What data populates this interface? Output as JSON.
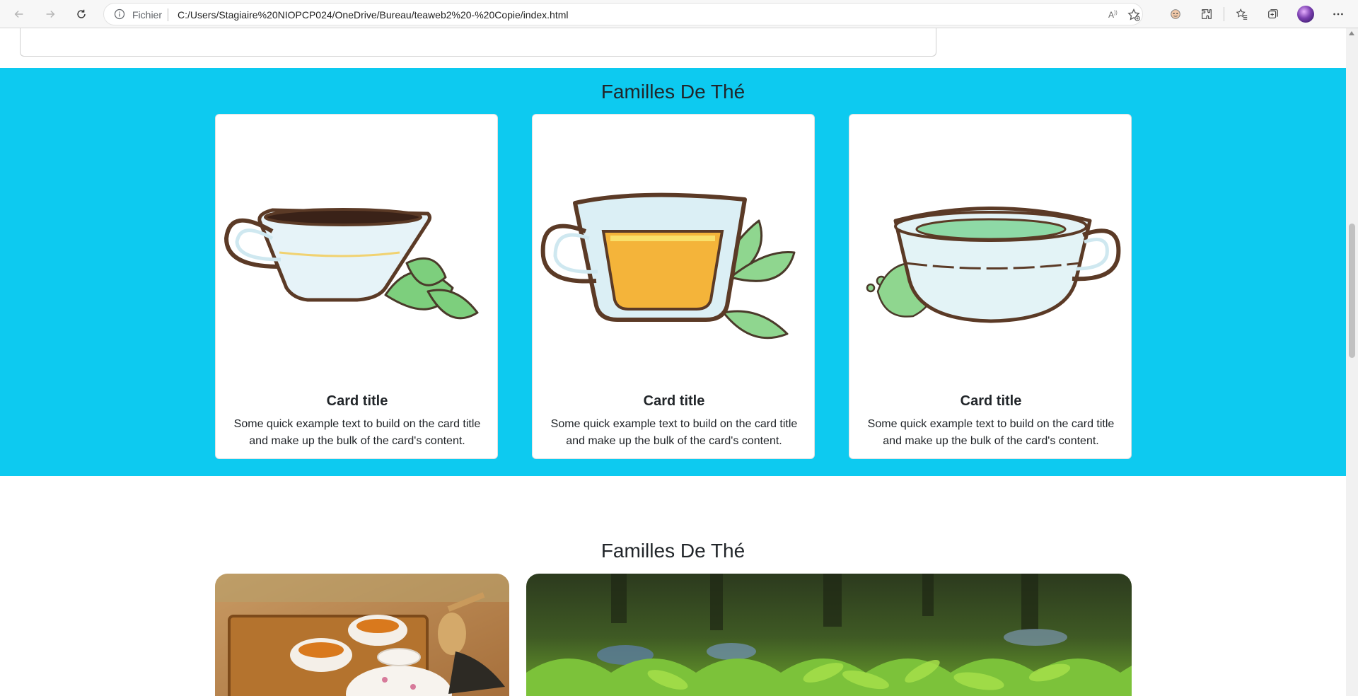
{
  "browser": {
    "scheme_label": "Fichier",
    "url": "C:/Users/Stagiaire%20NIOPCP024/OneDrive/Bureau/teaweb2%20-%20Copie/index.html",
    "icons": [
      "back-icon",
      "forward-icon",
      "refresh-icon",
      "info-icon",
      "read-aloud-icon",
      "add-favorite-icon",
      "extension-puzzle-icon",
      "extensions-icon",
      "favorites-icon",
      "collections-icon",
      "profile-avatar",
      "more-icon"
    ]
  },
  "featured_section": {
    "title": "Familles De Thé",
    "background_color": "#0dcaf0",
    "cards": [
      {
        "title": "Card title",
        "text": "Some quick example text to build on the card title and make up the bulk of the card's content.",
        "image": "black-tea-cup-illustration"
      },
      {
        "title": "Card title",
        "text": "Some quick example text to build on the card title and make up the bulk of the card's content.",
        "image": "golden-tea-glass-illustration"
      },
      {
        "title": "Card title",
        "text": "Some quick example text to build on the card title and make up the bulk of the card's content.",
        "image": "green-tea-cup-illustration"
      }
    ]
  },
  "gallery_section": {
    "title": "Familles De Thé",
    "photos": [
      "tea-set-on-bamboo-tray-photo",
      "tea-plantation-photo"
    ]
  }
}
